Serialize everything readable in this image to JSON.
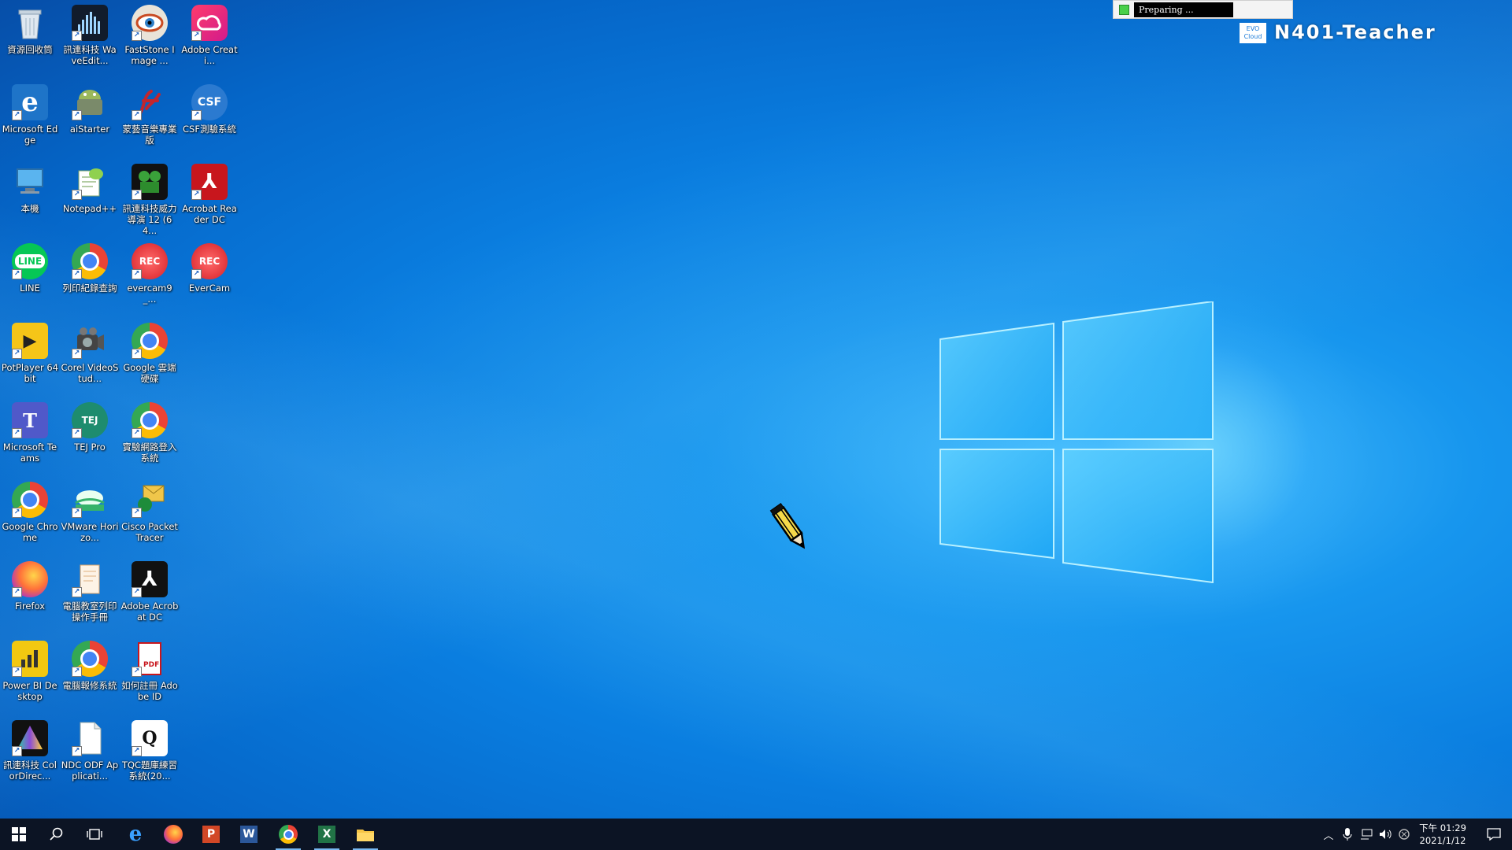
{
  "desktop": {
    "icons": [
      {
        "label": "資源回收筒",
        "icon": "recycle-bin-icon"
      },
      {
        "label": "訊連科技 WaveEdit...",
        "icon": "wave-editor-icon"
      },
      {
        "label": "FastStone Image ...",
        "icon": "faststone-icon"
      },
      {
        "label": "Adobe Creati...",
        "icon": "adobe-creative-cloud-icon"
      },
      {
        "label": "Microsoft Edge",
        "icon": "edge-icon"
      },
      {
        "label": "aiStarter",
        "icon": "aistarter-icon"
      },
      {
        "label": "蒙藝音樂專業版",
        "icon": "music-pro-icon"
      },
      {
        "label": "CSF測驗系統",
        "icon": "csf-icon"
      },
      {
        "label": "本機",
        "icon": "this-pc-icon"
      },
      {
        "label": "Notepad++",
        "icon": "notepad-plus-plus-icon"
      },
      {
        "label": "訊連科技威力導演 12 (64...",
        "icon": "powerdirector-icon"
      },
      {
        "label": "Acrobat Reader DC",
        "icon": "acrobat-reader-icon"
      },
      {
        "label": "LINE",
        "icon": "line-icon"
      },
      {
        "label": "列印紀錄查詢",
        "icon": "chrome-icon"
      },
      {
        "label": "evercam9_...",
        "icon": "evercam-setup-icon"
      },
      {
        "label": "EverCam",
        "icon": "evercam-icon"
      },
      {
        "label": "PotPlayer 64 bit",
        "icon": "potplayer-icon"
      },
      {
        "label": "Corel VideoStud...",
        "icon": "corel-videostudio-icon"
      },
      {
        "label": "Google 雲端硬碟",
        "icon": "chrome-icon"
      },
      {
        "label": "Microsoft Teams",
        "icon": "teams-icon"
      },
      {
        "label": "TEJ Pro",
        "icon": "tej-pro-icon"
      },
      {
        "label": "實驗網路登入系統",
        "icon": "chrome-icon"
      },
      {
        "label": "Google Chrome",
        "icon": "chrome-icon"
      },
      {
        "label": "VMware Horizo...",
        "icon": "vmware-horizon-icon"
      },
      {
        "label": "Cisco Packet Tracer",
        "icon": "cisco-packet-tracer-icon"
      },
      {
        "label": "Firefox",
        "icon": "firefox-icon"
      },
      {
        "label": "電腦教室列印操作手冊",
        "icon": "document-icon"
      },
      {
        "label": "Adobe Acrobat DC",
        "icon": "acrobat-dc-icon"
      },
      {
        "label": "Power BI Desktop",
        "icon": "power-bi-icon"
      },
      {
        "label": "電腦報修系統",
        "icon": "chrome-icon"
      },
      {
        "label": "如何註冊 Adobe ID",
        "icon": "pdf-file-icon"
      },
      {
        "label": "訊連科技 ColorDirec...",
        "icon": "colordirector-icon"
      },
      {
        "label": "NDC ODF Applicati...",
        "icon": "odf-application-icon"
      },
      {
        "label": "TQC題庫練習系統(20...",
        "icon": "tqc-icon"
      }
    ]
  },
  "remote": {
    "status_text": "Preparing ...",
    "cloud_badge": "EVO Cloud",
    "hostname": "N401-Teacher"
  },
  "taskbar": {
    "apps": [
      {
        "name": "start",
        "icon": "windows-start-icon"
      },
      {
        "name": "search",
        "icon": "search-icon"
      },
      {
        "name": "task view",
        "icon": "task-view-icon"
      },
      {
        "name": "Microsoft Edge",
        "icon": "edge-icon"
      },
      {
        "name": "Firefox",
        "icon": "firefox-icon"
      },
      {
        "name": "PowerPoint",
        "icon": "powerpoint-icon"
      },
      {
        "name": "Word",
        "icon": "word-icon"
      },
      {
        "name": "Google Chrome",
        "icon": "chrome-icon"
      },
      {
        "name": "Excel",
        "icon": "excel-icon"
      },
      {
        "name": "File Explorer",
        "icon": "file-explorer-icon"
      }
    ],
    "clock_time": "下午 01:29",
    "clock_date": "2021/1/12"
  },
  "colors": {
    "desktop_blue": "#0a7ee0",
    "taskbar": "#0c1424",
    "active_indicator": "#78b8f0"
  }
}
